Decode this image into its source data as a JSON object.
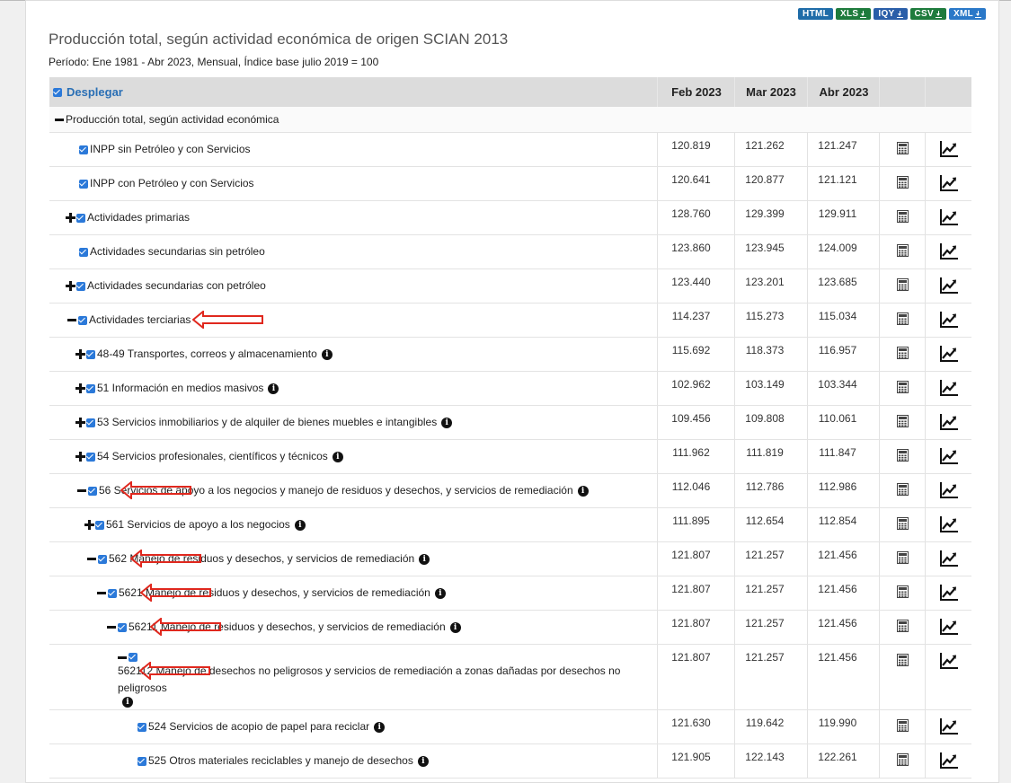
{
  "exports": [
    {
      "label": "HTML",
      "color": "#1f6ca8",
      "dl": false
    },
    {
      "label": "XLS",
      "color": "#1e7b3c",
      "dl": true
    },
    {
      "label": "IQY",
      "color": "#2a5ea8",
      "dl": true
    },
    {
      "label": "CSV",
      "color": "#1e7b3c",
      "dl": true
    },
    {
      "label": "XML",
      "color": "#2a78c8",
      "dl": true
    }
  ],
  "title": "Producción total, según actividad económica de origen SCIAN 2013",
  "subtitle": "Período: Ene 1981 - Abr 2023, Mensual, Índice base julio 2019 = 100",
  "header": {
    "toggle_label": "Desplegar",
    "columns": [
      "Feb 2023",
      "Mar 2023",
      "Abr 2023"
    ]
  },
  "group_label": "Producción total, según actividad económica",
  "rows": [
    {
      "indent": 33,
      "expander": "none",
      "label": "INPP sin Petróleo y con Servicios",
      "info": false,
      "values": [
        "120.819",
        "121.262",
        "121.247"
      ],
      "h": 37,
      "arrow": null
    },
    {
      "indent": 33,
      "expander": "none",
      "label": "INPP con Petróleo y con Servicios",
      "info": false,
      "values": [
        "120.641",
        "120.877",
        "121.121"
      ],
      "h": 37,
      "arrow": null
    },
    {
      "indent": 18,
      "expander": "plus",
      "label": "Actividades primarias",
      "info": false,
      "values": [
        "128.760",
        "129.399",
        "129.911"
      ],
      "h": 37,
      "arrow": null
    },
    {
      "indent": 33,
      "expander": "none",
      "label": "Actividades secundarias sin petróleo",
      "info": false,
      "values": [
        "123.860",
        "123.945",
        "124.009"
      ],
      "h": 37,
      "arrow": null
    },
    {
      "indent": 18,
      "expander": "plus",
      "label": "Actividades secundarias con petróleo",
      "info": false,
      "values": [
        "123.440",
        "123.201",
        "123.685"
      ],
      "h": 37,
      "arrow": null
    },
    {
      "indent": 20,
      "expander": "minus",
      "label": "Actividades terciarias",
      "info": false,
      "values": [
        "114.237",
        "115.273",
        "115.034"
      ],
      "h": 37,
      "arrow": "long"
    },
    {
      "indent": 29,
      "expander": "plus",
      "label": "48-49 Transportes, correos y almacenamiento",
      "info": true,
      "values": [
        "115.692",
        "118.373",
        "116.957"
      ],
      "h": 37,
      "arrow": null
    },
    {
      "indent": 29,
      "expander": "plus",
      "label": "51 Información en medios masivos",
      "info": true,
      "values": [
        "102.962",
        "103.149",
        "103.344"
      ],
      "h": 37,
      "arrow": null
    },
    {
      "indent": 29,
      "expander": "plus",
      "label": "53 Servicios inmobiliarios y de alquiler de bienes muebles e intangibles",
      "info": true,
      "values": [
        "109.456",
        "109.808",
        "110.061"
      ],
      "h": 37,
      "arrow": null
    },
    {
      "indent": 29,
      "expander": "plus",
      "label": "54 Servicios profesionales, científicos y técnicos",
      "info": true,
      "values": [
        "111.962",
        "111.819",
        "111.847"
      ],
      "h": 37,
      "arrow": null
    },
    {
      "indent": 31,
      "expander": "minus",
      "label": "56 Servicios de apoyo a los negocios y manejo de residuos y desechos, y servicios de remediación",
      "info": true,
      "values": [
        "112.046",
        "112.786",
        "112.986"
      ],
      "h": 37,
      "arrow": "short"
    },
    {
      "indent": 39,
      "expander": "plus",
      "label": "561 Servicios de apoyo a los negocios",
      "info": true,
      "values": [
        "111.895",
        "112.654",
        "112.854"
      ],
      "h": 37,
      "arrow": null
    },
    {
      "indent": 42,
      "expander": "minus",
      "label": "562 Manejo de residuos y desechos, y servicios de remediación",
      "info": true,
      "values": [
        "121.807",
        "121.257",
        "121.456"
      ],
      "h": 37,
      "arrow": "short"
    },
    {
      "indent": 53,
      "expander": "minus",
      "label": "5621 Manejo de residuos y desechos, y servicios de remediación",
      "info": true,
      "values": [
        "121.807",
        "121.257",
        "121.456"
      ],
      "h": 37,
      "arrow": "short"
    },
    {
      "indent": 64,
      "expander": "minus",
      "label": "56211 Manejo de residuos y desechos, y servicios de remediación",
      "info": true,
      "values": [
        "121.807",
        "121.257",
        "121.456"
      ],
      "h": 37,
      "arrow": "short"
    },
    {
      "indent": 76,
      "expander": "minus",
      "label": "562112 Manejo de desechos no peligrosos y servicios de remediación a zonas dañadas por desechos no peligrosos",
      "info": true,
      "values": [
        "121.807",
        "121.257",
        "121.456"
      ],
      "h": 72,
      "arrow": "short",
      "wrap": true
    },
    {
      "indent": 98,
      "expander": "none",
      "label": "524 Servicios de acopio de papel para reciclar",
      "info": true,
      "values": [
        "121.630",
        "119.642",
        "119.990"
      ],
      "h": 37,
      "arrow": null
    },
    {
      "indent": 98,
      "expander": "none",
      "label": "525 Otros materiales reciclables y manejo de desechos",
      "info": true,
      "values": [
        "121.905",
        "122.143",
        "122.261"
      ],
      "h": 37,
      "arrow": null
    }
  ],
  "icons": {
    "calc": "calculator-icon",
    "trend": "trend-chart-icon",
    "info": "info-icon"
  },
  "accent": "#2b79d9",
  "arrow_color": "#e0281e"
}
